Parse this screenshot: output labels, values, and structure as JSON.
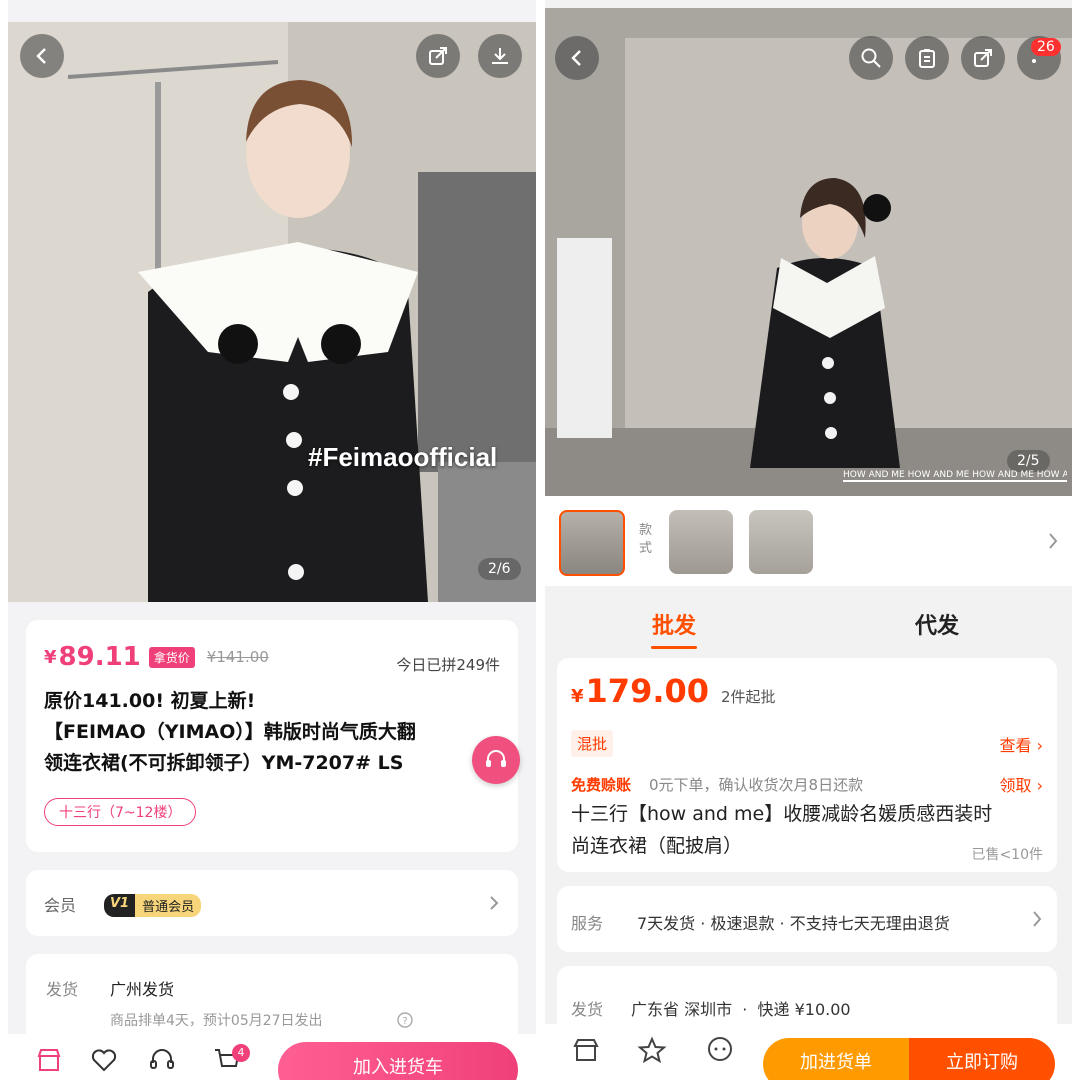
{
  "left": {
    "photo": {
      "counter": "2/6",
      "watermark": "#Feimaoofficial"
    },
    "price": {
      "currency": "¥",
      "value": "89.11",
      "tag": "拿货价",
      "original": "¥141.00",
      "sold": "今日已拼249件"
    },
    "title_lines": [
      "原价141.00! 初夏上新!",
      "【FEIMAO（YIMAO）】韩版时尚气质大翻",
      "领连衣裙(不可拆卸领子）YM-7207#  LS"
    ],
    "location_chip": "十三行（7~12楼）",
    "member": {
      "label": "会员",
      "badge_v": "V1",
      "badge_text": "普通会员"
    },
    "shipping": {
      "label": "发货",
      "value": "广州发货",
      "note": "商品排单4天，预计05月27日发出"
    },
    "bottom_bar": {
      "cart_count": "4",
      "cta": "加入进货车"
    },
    "colors": {
      "accent": "#f0407a"
    }
  },
  "right": {
    "photo": {
      "counter": "2/5",
      "badge_count": "26",
      "strip_text": "HOW AND ME HOW AND ME HOW AND ME HOW AND ME"
    },
    "thumbs_label": "款式",
    "tabs": {
      "active": "批发",
      "other": "代发"
    },
    "price": {
      "currency": "¥",
      "value": "179.00",
      "min": "2件起批"
    },
    "mix": {
      "tag": "混批",
      "link": "查看"
    },
    "credit": {
      "title": "免费赊账",
      "desc": "0元下单，确认收货次月8日还款",
      "link": "领取"
    },
    "title_lines": [
      "十三行【how and me】收腰减龄名媛质感西装时",
      "尚连衣裙（配披肩）"
    ],
    "sold": "已售<10件",
    "service": {
      "label": "服务",
      "value": "7天发货 · 极速退款 · 不支持七天无理由退货"
    },
    "shipping": {
      "label": "发货",
      "value": "广东省 深圳市  ·  快递 ¥10.00"
    },
    "bottom_bar": {
      "cta_primary": "加进货单",
      "cta_secondary": "立即订购"
    },
    "colors": {
      "accent": "#ff5000",
      "orange": "#ff9900"
    }
  }
}
